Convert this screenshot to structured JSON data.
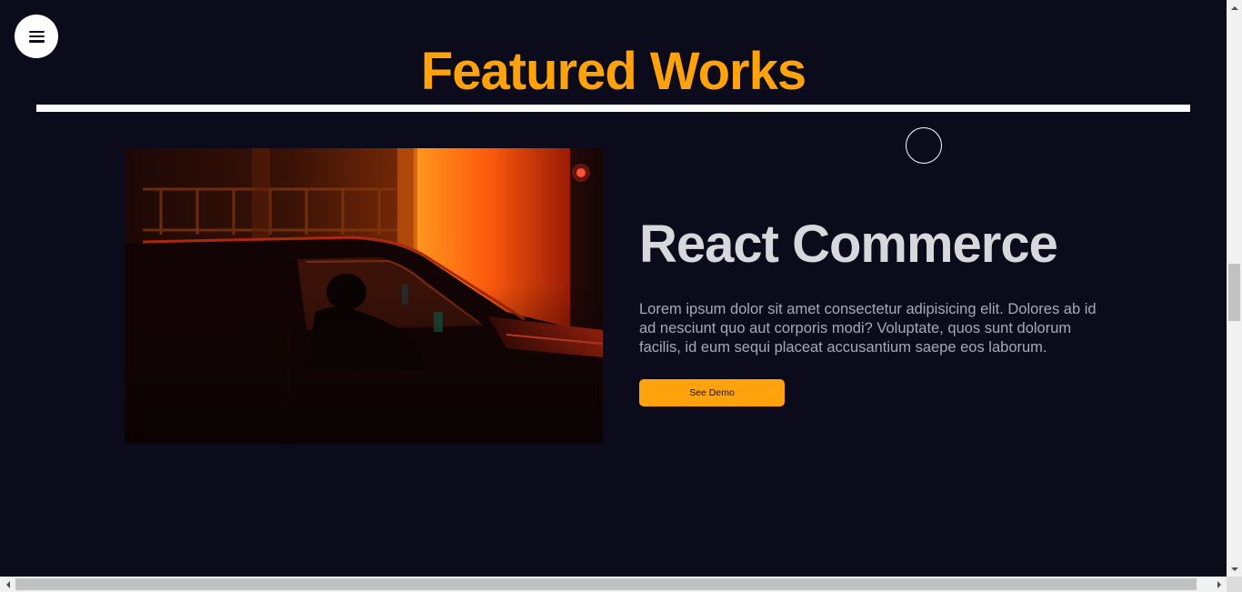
{
  "header": {
    "menu_icon": "hamburger-menu-icon",
    "title": "Featured Works"
  },
  "project": {
    "title": "React Commerce",
    "description": "Lorem ipsum dolor sit amet consectetur adipisicing elit. Dolores ab id ad nesciunt quo aut corporis modi? Voluptate, quos sunt dolorum facilis, id eum sequi placeat accusantium saepe eos laborum.",
    "button_label": "See Demo",
    "image_icon": "car-at-night-photo"
  },
  "colors": {
    "background": "#0c0b1c",
    "accent": "#ffa20b",
    "title_text": "#d8d7dc",
    "body_text": "#a9a8b4",
    "divider": "#ffffff"
  }
}
